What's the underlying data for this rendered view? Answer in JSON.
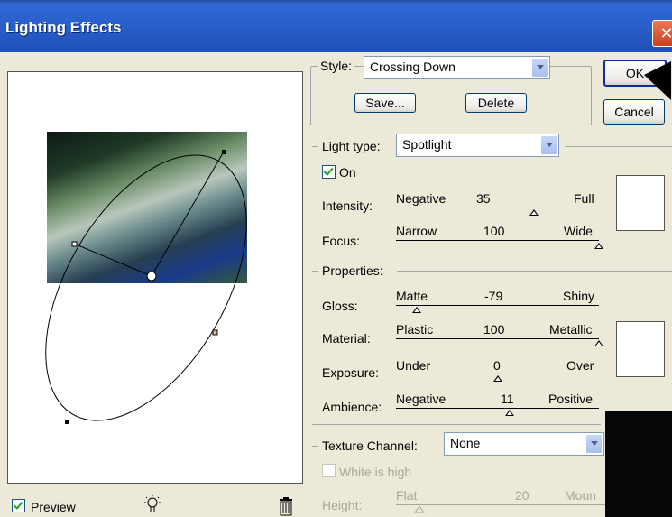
{
  "window": {
    "title": "Lighting Effects",
    "close_glyph": "✕"
  },
  "style": {
    "label": "Style:",
    "value": "Crossing Down",
    "save_label": "Save...",
    "delete_label": "Delete"
  },
  "buttons": {
    "ok": "OK",
    "cancel": "Cancel"
  },
  "light_type": {
    "label": "Light type:",
    "value": "Spotlight",
    "on_label": "On",
    "on_checked": true,
    "intensity": {
      "label": "Intensity:",
      "min": "Negative",
      "value": "35",
      "max": "Full",
      "fraction": 0.68
    },
    "focus": {
      "label": "Focus:",
      "min": "Narrow",
      "value": "100",
      "max": "Wide",
      "fraction": 1.0
    }
  },
  "properties": {
    "label": "Properties:",
    "gloss": {
      "label": "Gloss:",
      "min": "Matte",
      "value": "-79",
      "max": "Shiny",
      "fraction": 0.1
    },
    "material": {
      "label": "Material:",
      "min": "Plastic",
      "value": "100",
      "max": "Metallic",
      "fraction": 1.0
    },
    "exposure": {
      "label": "Exposure:",
      "min": "Under",
      "value": "0",
      "max": "Over",
      "fraction": 0.5
    },
    "ambience": {
      "label": "Ambience:",
      "min": "Negative",
      "value": "11",
      "max": "Positive",
      "fraction": 0.56
    }
  },
  "texture": {
    "label": "Texture Channel:",
    "value": "None",
    "white_is_high": "White is high",
    "height": {
      "label": "Height:",
      "min": "Flat",
      "value": "20",
      "max": "Moun"
    }
  },
  "preview": {
    "label": "Preview",
    "checked": true
  },
  "icons": {
    "light": "light-bulb-icon",
    "trash": "trash-icon"
  }
}
